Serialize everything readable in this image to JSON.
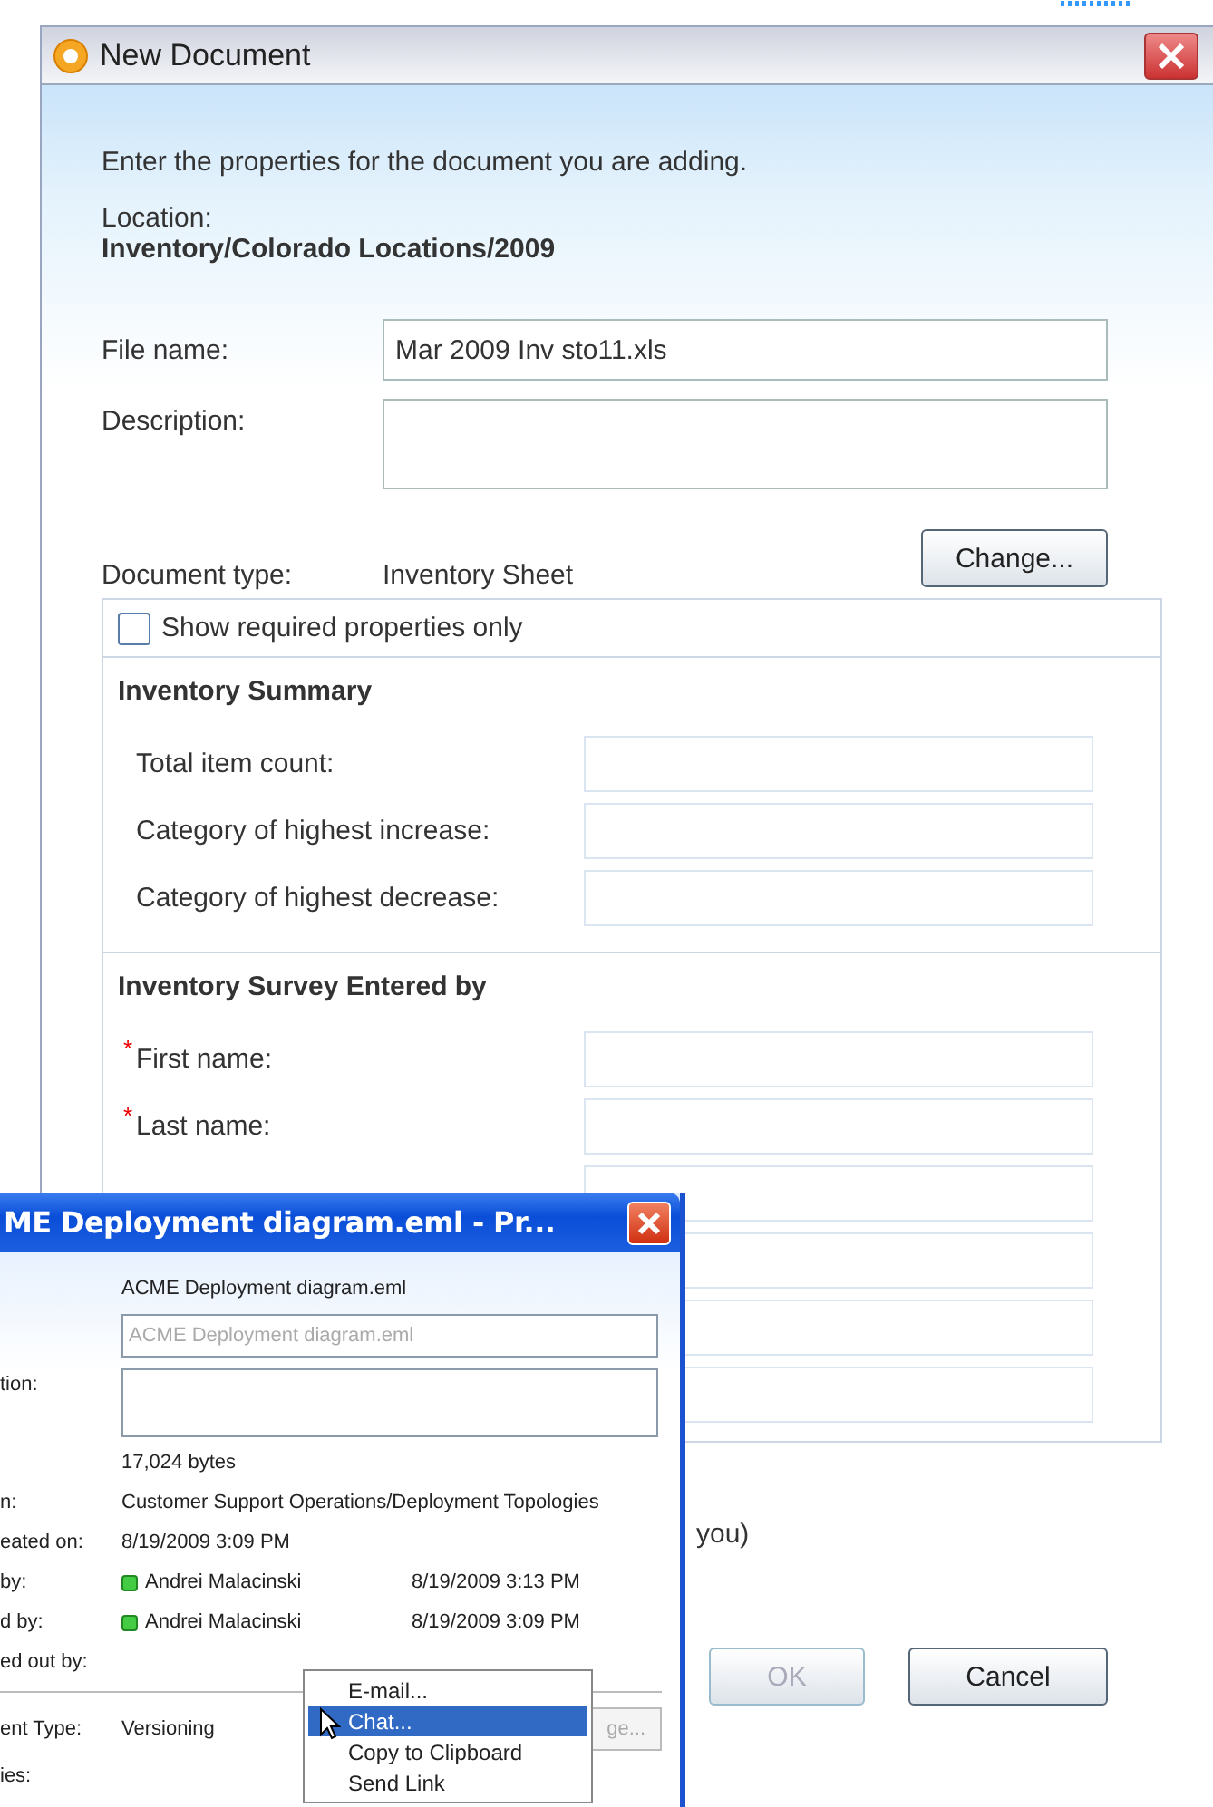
{
  "dialog": {
    "title": "New Document",
    "intro": "Enter the properties for the document you are adding.",
    "location_label": "Location:",
    "location": "Inventory/Colorado Locations/2009",
    "file_name": {
      "label": "File name:",
      "value": "Mar 2009 Inv sto11.xls"
    },
    "description": {
      "label": "Description:"
    },
    "document_type": {
      "label": "Document type:",
      "value": "Inventory Sheet",
      "button": "Change..."
    },
    "required_only": {
      "label": "Show required properties only",
      "checked": false
    },
    "sections": [
      {
        "title": "Inventory Summary",
        "fields": [
          {
            "kind": "field",
            "label": "Total item count:"
          },
          {
            "kind": "field",
            "label": "Category of highest increase:"
          },
          {
            "kind": "field",
            "label": "Category of highest decrease:"
          }
        ]
      },
      {
        "title": "Inventory Survey Entered by",
        "fields": [
          {
            "kind": "field",
            "label": "First name:",
            "required_mark": "*"
          },
          {
            "kind": "field",
            "label": "Last name:",
            "required_mark": "*"
          },
          {
            "kind": "field"
          },
          {
            "kind": "field"
          },
          {
            "kind": "field"
          },
          {
            "kind": "field"
          }
        ]
      }
    ],
    "note_fragment": "you)",
    "buttons": [
      {
        "label": "OK",
        "disabled": true
      },
      {
        "label": "Cancel",
        "disabled": false
      }
    ]
  },
  "properties_window": {
    "title": "ME Deployment diagram.eml - Pr...",
    "name_value": "ACME Deployment diagram.eml",
    "name_field": "ACME Deployment diagram.eml",
    "description_label": "tion:",
    "rows": [
      {
        "value": "17,024 bytes"
      },
      {
        "label": "n:",
        "value": "Customer Support Operations/Deployment Topologies"
      },
      {
        "label": "eated on:",
        "value": "8/19/2009 3:09 PM"
      },
      {
        "label": "by:",
        "user": "Andrei Malacinski",
        "date": "8/19/2009 3:13 PM"
      },
      {
        "label": "d by:",
        "user": "Andrei Malacinski",
        "date": "8/19/2009 3:09 PM"
      },
      {
        "label": "ed out by:"
      }
    ],
    "type_label": "ent Type:",
    "type_value": "Versioning",
    "type_button": "ge...",
    "last_label": "ies:"
  },
  "context_menu": {
    "items": [
      {
        "label": "E-mail...",
        "selected": false
      },
      {
        "label": "Chat...",
        "selected": true
      },
      {
        "label": "Copy to Clipboard",
        "selected": false
      },
      {
        "label": "Send Link",
        "selected": false
      }
    ]
  }
}
